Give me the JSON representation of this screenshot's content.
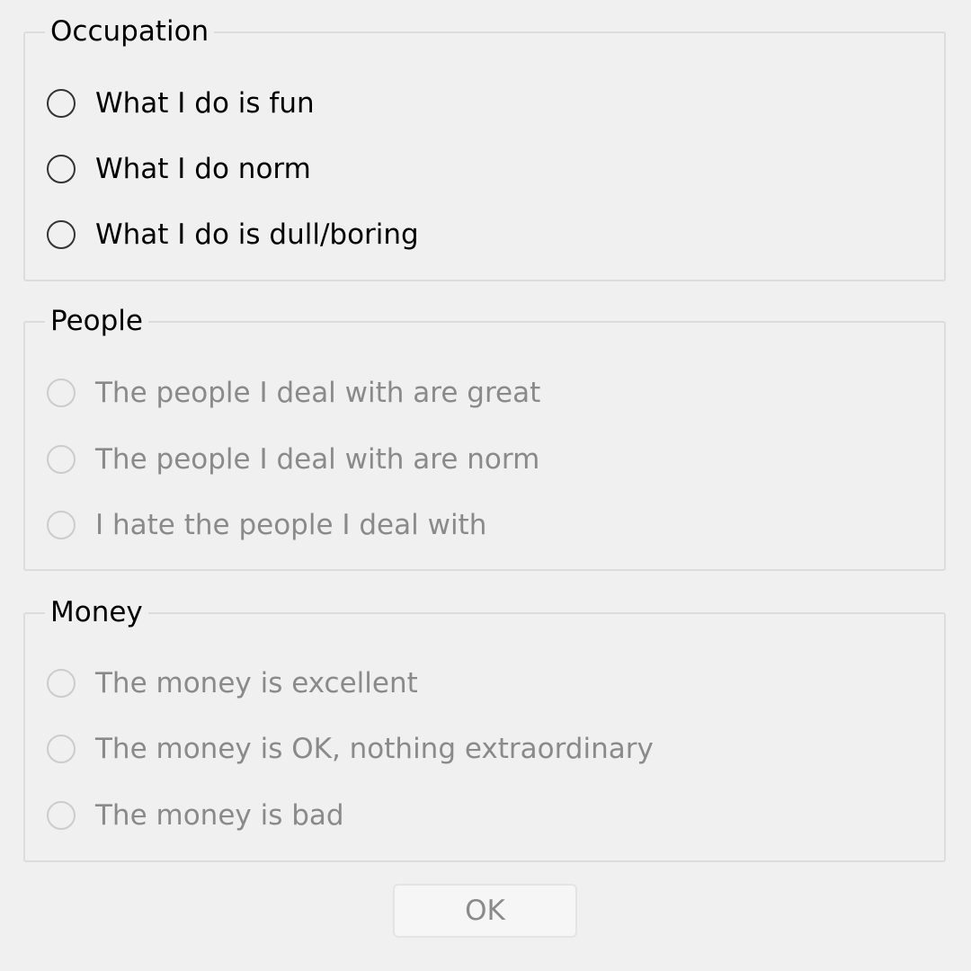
{
  "groups": {
    "occupation": {
      "title": "Occupation",
      "enabled": true,
      "options": [
        {
          "label": "What I do is fun",
          "selected": false
        },
        {
          "label": "What I do norm",
          "selected": false
        },
        {
          "label": "What I do is dull/boring",
          "selected": false
        }
      ]
    },
    "people": {
      "title": "People",
      "enabled": false,
      "options": [
        {
          "label": "The people I deal with are great",
          "selected": false
        },
        {
          "label": "The people I deal with are norm",
          "selected": false
        },
        {
          "label": "I hate the people I deal with",
          "selected": false
        }
      ]
    },
    "money": {
      "title": "Money",
      "enabled": false,
      "options": [
        {
          "label": "The money is excellent",
          "selected": false
        },
        {
          "label": "The money is OK, nothing extraordinary",
          "selected": false
        },
        {
          "label": "The money is bad",
          "selected": false
        }
      ]
    }
  },
  "buttons": {
    "ok_label": "OK",
    "ok_enabled": false
  }
}
